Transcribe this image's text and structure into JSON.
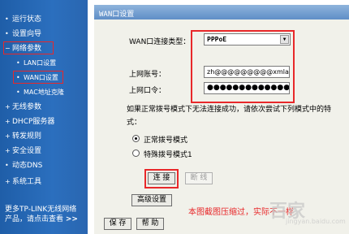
{
  "sidebar": {
    "items": [
      {
        "label": "运行状态"
      },
      {
        "label": "设置向导"
      },
      {
        "label": "网络参数"
      },
      {
        "label": "LAN口设置"
      },
      {
        "label": "WAN口设置"
      },
      {
        "label": "MAC地址克隆"
      },
      {
        "label": "无线参数"
      },
      {
        "label": "DHCP服务器"
      },
      {
        "label": "转发规则"
      },
      {
        "label": "安全设置"
      },
      {
        "label": "动态DNS"
      },
      {
        "label": "系统工具"
      }
    ],
    "footer_line1": "更多TP-LINK无线网络",
    "footer_line2": "产品，请点击查看",
    "footer_arrow": ">>"
  },
  "main": {
    "title": "WAN口设置",
    "connection_type_label": "WAN口连接类型：",
    "connection_type_value": "PPPoE",
    "account_label": "上网账号：",
    "account_value": "zh@@@@@@@@@xmlan",
    "password_label": "上网口令：",
    "password_value": "●●●●●●●●●●●●●●●",
    "hint_line1": "如果正常拨号模式下无法连接成功，请依次尝试下列模式中的特",
    "hint_line2": "式：",
    "mode_normal": "正常拨号模式",
    "mode_special": "特殊拨号模式1",
    "connect_button": "连 接",
    "disconnect_button": "断 线",
    "advanced_button": "高级设置",
    "save_button": "保 存",
    "help_button": "帮 助",
    "note": "本图截图压缩过，实际不一样",
    "watermark": "百家",
    "watermark_sub": "jingyan.baidu.com"
  },
  "colors": {
    "sidebar": "#2b6fbe",
    "highlight": "#e8282a",
    "title_bar": "#6f9bd0"
  }
}
